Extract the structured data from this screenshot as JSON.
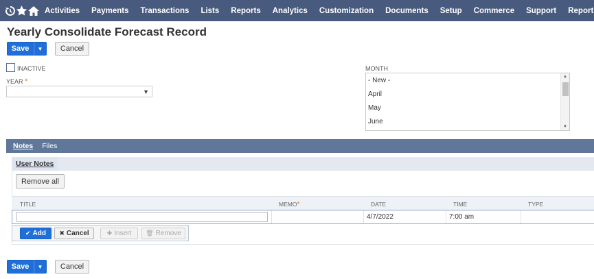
{
  "nav": {
    "items": [
      "Activities",
      "Payments",
      "Transactions",
      "Lists",
      "Reports",
      "Analytics",
      "Customization",
      "Documents",
      "Setup",
      "Commerce",
      "Support",
      "Reports"
    ]
  },
  "page": {
    "title": "Yearly Consolidate Forecast Record"
  },
  "toolbar": {
    "save_label": "Save",
    "cancel_label": "Cancel"
  },
  "form": {
    "inactive_label": "INACTIVE",
    "year_label": "YEAR",
    "year_value": "",
    "month_label": "MONTH",
    "month_options": [
      "- New -",
      "April",
      "May",
      "June"
    ]
  },
  "subtabs": [
    "Notes",
    "Files"
  ],
  "user_notes": {
    "tab_label": "User Notes",
    "remove_all_label": "Remove all",
    "columns": [
      "TITLE",
      "MEMO",
      "DATE",
      "TIME",
      "TYPE"
    ],
    "row": {
      "title": "",
      "memo": "",
      "date": "4/7/2022",
      "time": "7:00 am",
      "type": ""
    },
    "buttons": {
      "add": "Add",
      "cancel": "Cancel",
      "insert": "Insert",
      "remove": "Remove"
    }
  },
  "colors": {
    "nav_bg": "#485a7d",
    "primary": "#1e6fd9",
    "subtab_bg": "#607799",
    "required": "#e07a1f"
  },
  "icons": [
    "recent-icon",
    "star-icon",
    "home-icon",
    "dropdown-arrow-icon",
    "checkmark-icon",
    "x-icon",
    "plus-icon",
    "trash-icon"
  ]
}
